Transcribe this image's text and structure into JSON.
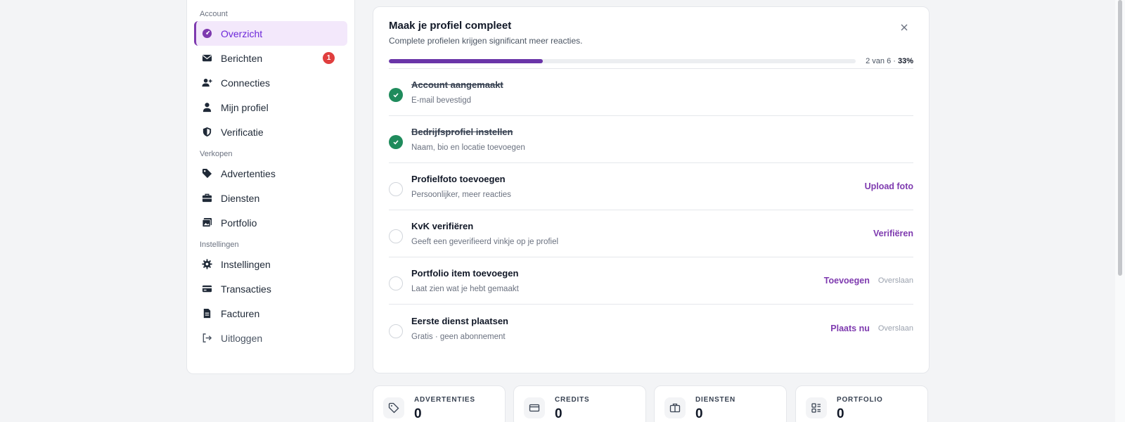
{
  "sidebar": {
    "sections": [
      {
        "title": "Account"
      },
      {
        "title": "Verkopen"
      },
      {
        "title": "Instellingen"
      }
    ],
    "items": [
      {
        "label": "Overzicht",
        "icon": "dashboard-icon"
      },
      {
        "label": "Berichten",
        "icon": "envelope-icon",
        "badge": "1"
      },
      {
        "label": "Connecties",
        "icon": "user-plus-icon"
      },
      {
        "label": "Mijn profiel",
        "icon": "user-icon"
      },
      {
        "label": "Verificatie",
        "icon": "shield-icon"
      },
      {
        "label": "Advertenties",
        "icon": "tag-icon"
      },
      {
        "label": "Diensten",
        "icon": "briefcase-icon"
      },
      {
        "label": "Portfolio",
        "icon": "image-icon"
      },
      {
        "label": "Instellingen",
        "icon": "gear-icon"
      },
      {
        "label": "Transacties",
        "icon": "credit-card-icon"
      },
      {
        "label": "Facturen",
        "icon": "file-icon"
      },
      {
        "label": "Uitloggen",
        "icon": "logout-icon"
      }
    ],
    "active_item": "Overzicht"
  },
  "profile_card": {
    "title": "Maak je profiel compleet",
    "subtitle": "Complete profielen krijgen significant meer reacties.",
    "progress": {
      "fraction": 0.33,
      "label_count": "2 van 6 · ",
      "label_percent": "33%"
    },
    "tasks": [
      {
        "title": "Account aangemaakt",
        "subtitle": "E-mail bevestigd",
        "done": true
      },
      {
        "title": "Bedrijfsprofiel instellen",
        "subtitle": "Naam, bio en locatie toevoegen",
        "done": true
      },
      {
        "title": "Profielfoto toevoegen",
        "subtitle": "Persoonlijker, meer reacties",
        "done": false,
        "action": "Upload foto"
      },
      {
        "title": "KvK verifiëren",
        "subtitle": "Geeft een geverifieerd vinkje op je profiel",
        "done": false,
        "action": "Verifiëren"
      },
      {
        "title": "Portfolio item toevoegen",
        "subtitle": "Laat zien wat je hebt gemaakt",
        "done": false,
        "action": "Toevoegen",
        "skip": "Overslaan"
      },
      {
        "title": "Eerste dienst plaatsen",
        "subtitle": "Gratis · geen abonnement",
        "done": false,
        "action": "Plaats nu",
        "skip": "Overslaan"
      }
    ]
  },
  "stats": [
    {
      "label": "ADVERTENTIES",
      "value": "0",
      "icon": "tag-icon"
    },
    {
      "label": "CREDITS",
      "value": "0",
      "icon": "credit-card-icon"
    },
    {
      "label": "DIENSTEN",
      "value": "0",
      "icon": "briefcase-icon"
    },
    {
      "label": "PORTFOLIO",
      "value": "0",
      "icon": "layout-icon"
    }
  ],
  "colors": {
    "accent": "#7e3aaf",
    "progress": "#6a35a8",
    "success": "#1f8b5c",
    "badge": "#e03e3e"
  }
}
